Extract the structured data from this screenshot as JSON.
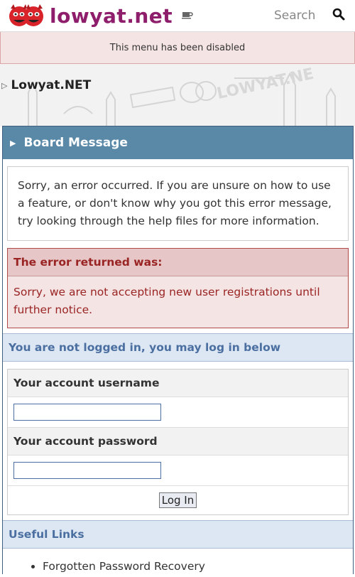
{
  "header": {
    "logo_text": "lowyat.net",
    "search_placeholder": "Search"
  },
  "notice": {
    "menu_disabled": "This menu has been disabled"
  },
  "breadcrumb": {
    "label": "Lowyat.NET"
  },
  "board": {
    "title": "Board Message",
    "info": "Sorry, an error occurred. If you are unsure on how to use a feature, or don't know why you got this error message, try looking through the help files for more information.",
    "error_title": "The error returned was:",
    "error_body": "Sorry, we are not accepting new user registrations until further notice."
  },
  "login": {
    "section_title": "You are not logged in, you may log in below",
    "username_label": "Your account username",
    "password_label": "Your account password",
    "button_label": "Log In"
  },
  "useful_links": {
    "title": "Useful Links",
    "items": [
      "Forgotten Password Recovery"
    ]
  },
  "colors": {
    "brand": "#8e1d6b",
    "board_header": "#5a89a8",
    "error_text": "#9a2424",
    "section_text": "#4a6fa0"
  },
  "icons": {
    "logo": "devil-faces-logo",
    "cup": "coffee-cup-icon",
    "search": "magnifier-icon",
    "breadcrumb": "triangle-right-icon",
    "board": "caret-right-icon"
  }
}
